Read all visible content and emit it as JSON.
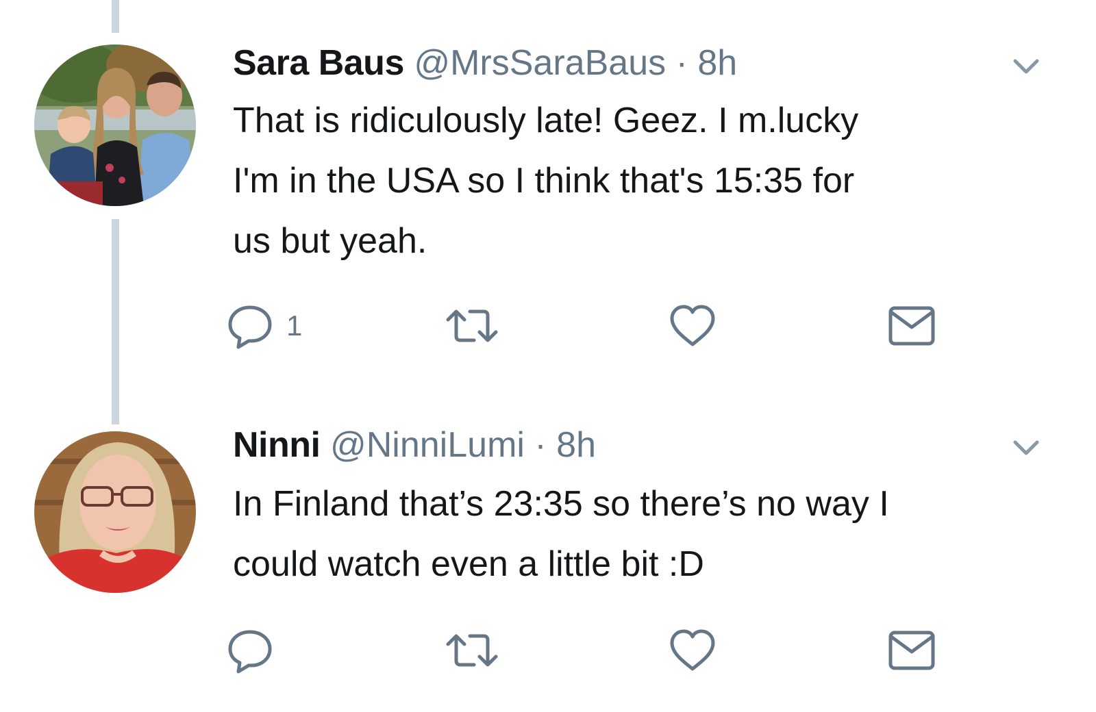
{
  "colors": {
    "text_primary": "#14171a",
    "text_secondary": "#657786",
    "thread_line": "#ccd6dd",
    "icon": "#657786"
  },
  "tweets": [
    {
      "name": "Sara Baus",
      "handle": "@MrsSaraBaus",
      "separator": "·",
      "time": "8h",
      "text": "That is ridiculously late! Geez. I m.lucky\nI'm in the USA so I think that's 15:35 for\nus but yeah.",
      "reply_count": "1",
      "retweet_count": "",
      "like_count": "",
      "icons": [
        "reply-icon",
        "retweet-icon",
        "like-icon",
        "direct-message-icon",
        "chevron-down-icon"
      ]
    },
    {
      "name": "Ninni",
      "handle": "@NinniLumi",
      "separator": "·",
      "time": "8h",
      "text": "In Finland that’s 23:35 so there’s no way I\ncould watch even a little bit :D",
      "reply_count": "",
      "retweet_count": "",
      "like_count": "",
      "icons": [
        "reply-icon",
        "retweet-icon",
        "like-icon",
        "direct-message-icon",
        "chevron-down-icon"
      ]
    }
  ]
}
